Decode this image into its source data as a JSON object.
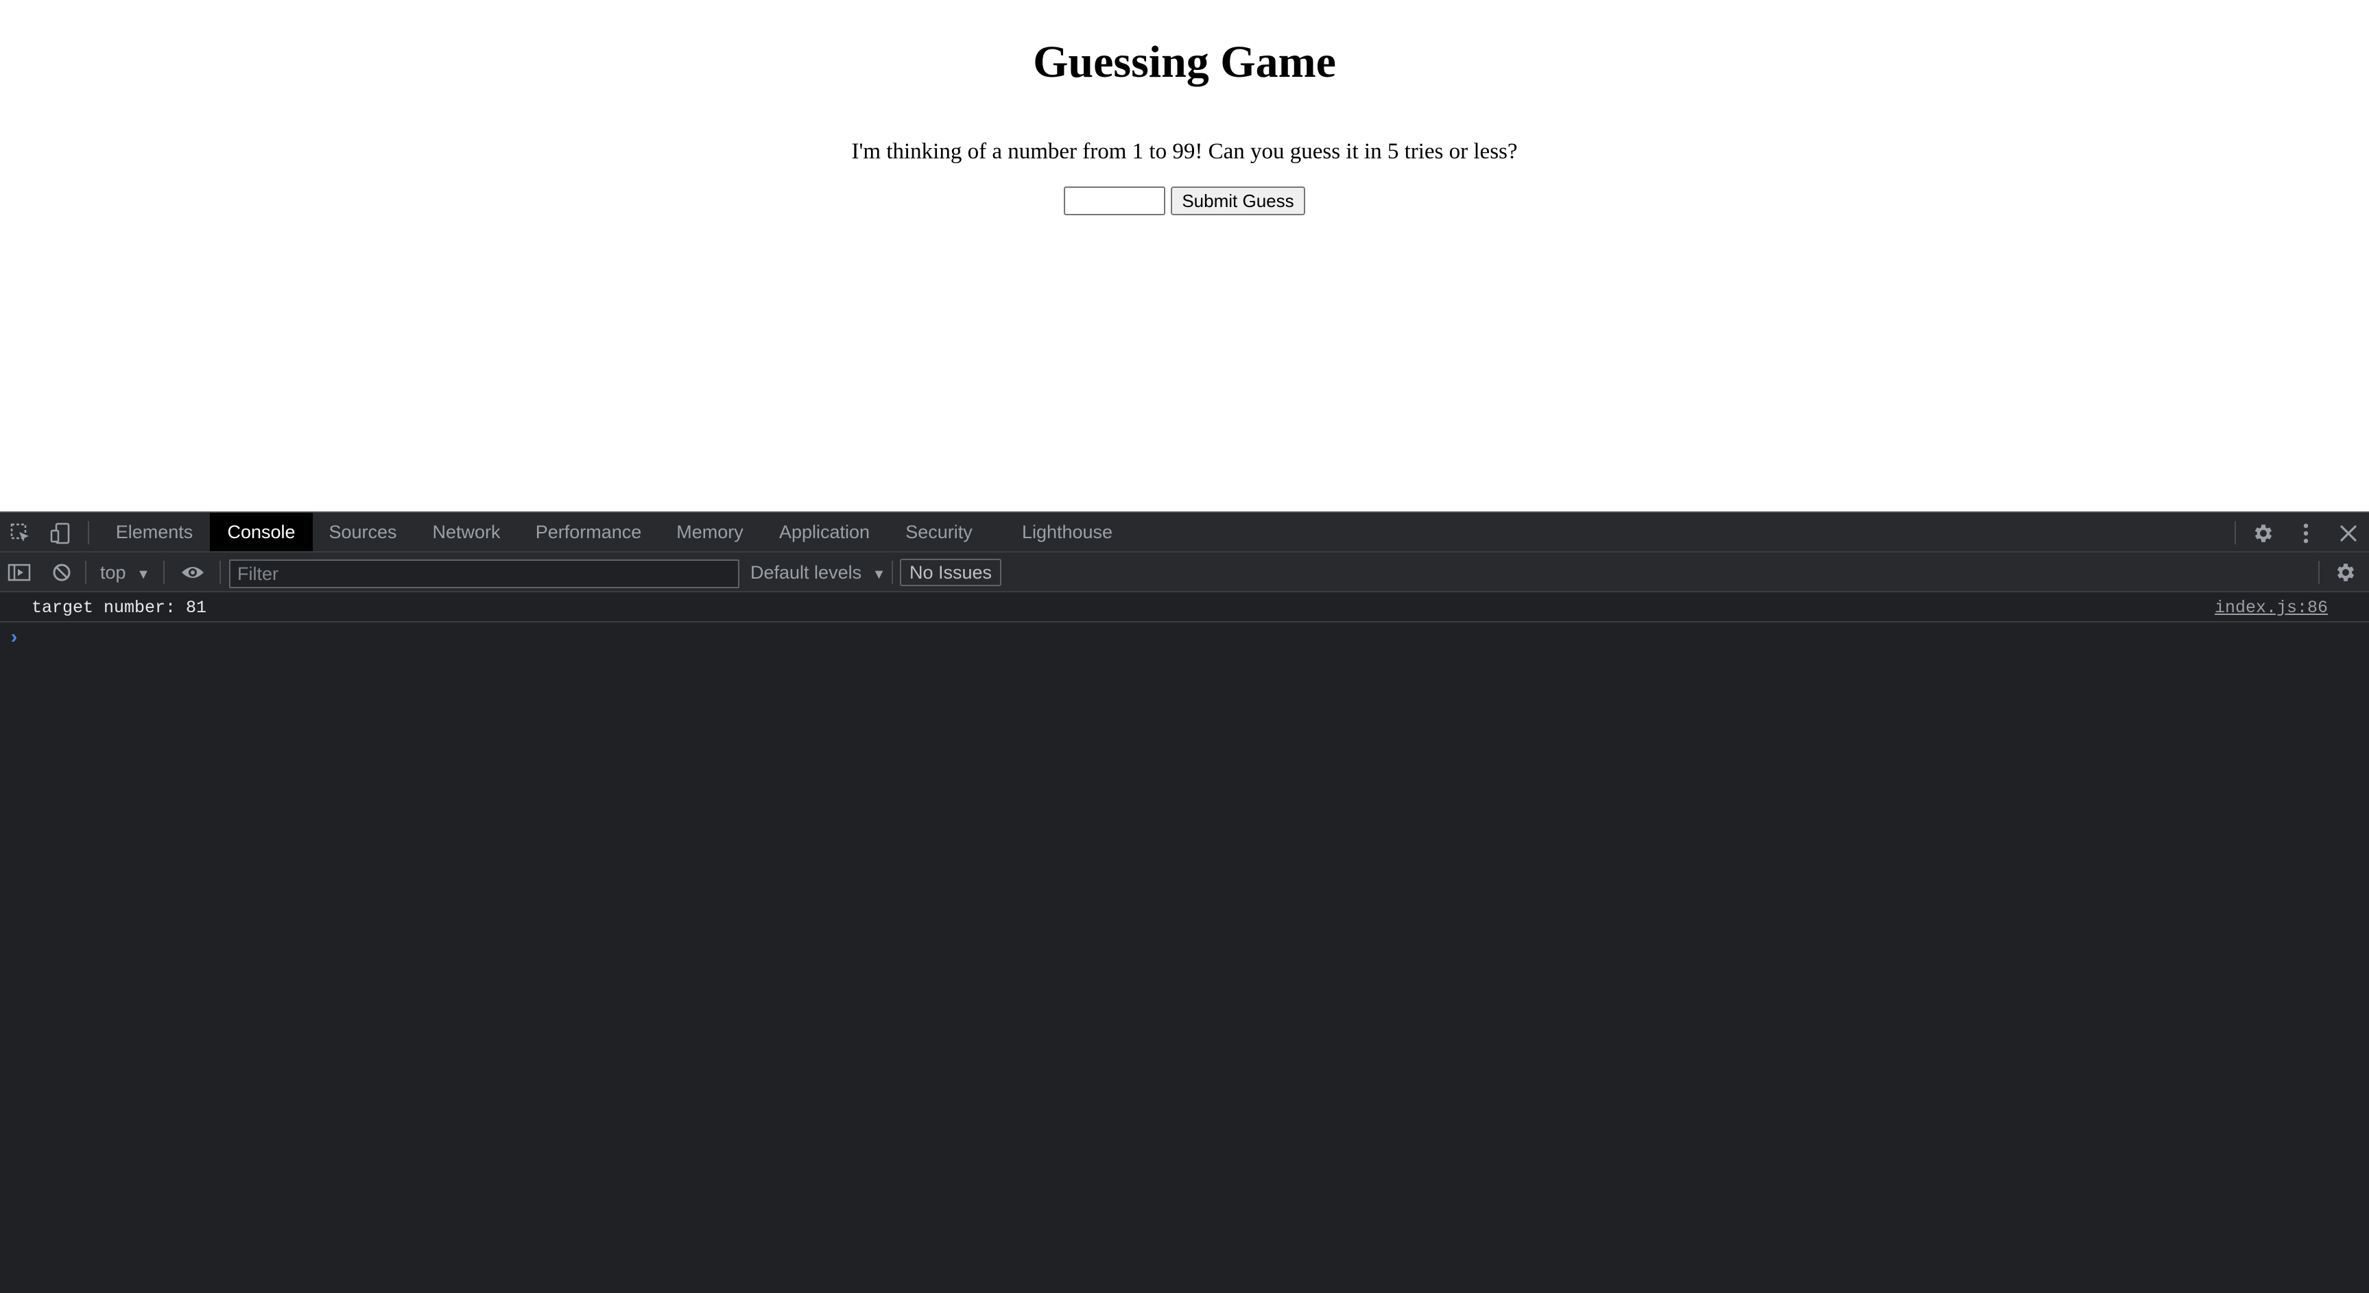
{
  "page": {
    "title": "Guessing Game",
    "intro": "I'm thinking of a number from 1 to 99! Can you guess it in 5 tries or less?",
    "guess_input_value": "",
    "submit_label": "Submit Guess"
  },
  "devtools": {
    "tabs": [
      {
        "label": "Elements",
        "active": false
      },
      {
        "label": "Console",
        "active": true
      },
      {
        "label": "Sources",
        "active": false
      },
      {
        "label": "Network",
        "active": false
      },
      {
        "label": "Performance",
        "active": false
      },
      {
        "label": "Memory",
        "active": false
      },
      {
        "label": "Application",
        "active": false
      },
      {
        "label": "Security",
        "active": false
      },
      {
        "label": "Lighthouse",
        "active": false
      }
    ],
    "icons": {
      "inspect": "inspect-element-icon",
      "device": "device-toolbar-icon",
      "settings": "gear-icon",
      "more": "kebab-menu-icon",
      "close": "close-icon",
      "sidebar": "sidebar-toggle-icon",
      "clear": "clear-console-icon",
      "eye": "live-expression-eye-icon",
      "console_settings": "gear-icon"
    },
    "toolbar": {
      "context": "top",
      "filter_placeholder": "Filter",
      "levels": "Default levels",
      "issues": "No Issues"
    },
    "console": {
      "messages": [
        {
          "text": "target number: 81",
          "source": "index.js:86"
        }
      ],
      "prompt": "›"
    },
    "colors": {
      "panel_bg": "#202124",
      "toolbar_bg": "#292a2d",
      "active_tab_bg": "#000000",
      "prompt": "#4a8af4"
    }
  }
}
